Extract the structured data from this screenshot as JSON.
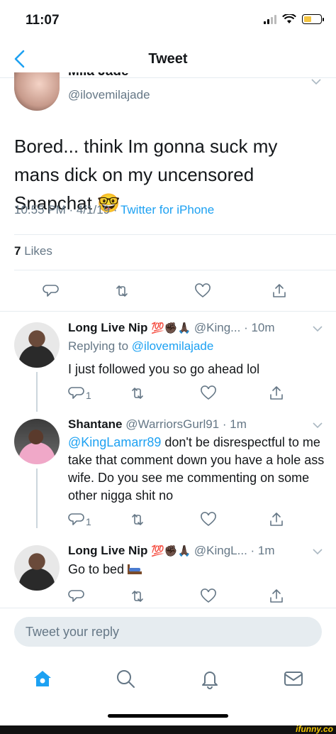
{
  "status": {
    "time": "11:07"
  },
  "nav": {
    "title": "Tweet"
  },
  "main_tweet": {
    "name_cut": "Mila Jade",
    "handle": "@ilovemilajade",
    "text": "Bored... think Im gonna suck my mans dick on my uncensored Snapchat 🤓",
    "time": "10:55 PM · 4/1/19 · ",
    "source": "Twitter for iPhone",
    "likes_count": "7",
    "likes_label": "Likes"
  },
  "replies": [
    {
      "name": "Long Live Nip",
      "emojis": "💯✊🏿🙏🏿",
      "handle": "@King...",
      "time": " · 10m",
      "replying_prefix": "Replying to ",
      "replying_to": "@ilovemilajade",
      "body": "I just followed you so go ahead lol",
      "reply_count": "1"
    },
    {
      "name": "Shantane",
      "handle": "@WarriorsGurl91",
      "time": " · 1m",
      "mention": "@KingLamarr89",
      "body": " don't be disrespectful to me take that comment down you have a hole ass wife. Do you see me commenting on some other nigga shit no",
      "reply_count": "1"
    },
    {
      "name": "Long Live Nip",
      "emojis": "💯✊🏿🙏🏿",
      "handle": "@KingL...",
      "time": " · 1m",
      "body": "Go to bed"
    }
  ],
  "reply_bar": {
    "placeholder": "Tweet your reply"
  },
  "icons": {
    "back": "chevron-left-icon",
    "reply": "reply-icon",
    "retweet": "retweet-icon",
    "like": "heart-icon",
    "share": "share-icon",
    "home": "home-icon",
    "search": "search-icon",
    "notifications": "bell-icon",
    "messages": "mail-icon"
  },
  "colors": {
    "accent": "#1da1f2",
    "muted": "#657786",
    "text": "#14171a"
  },
  "watermark": "ifunny.co"
}
